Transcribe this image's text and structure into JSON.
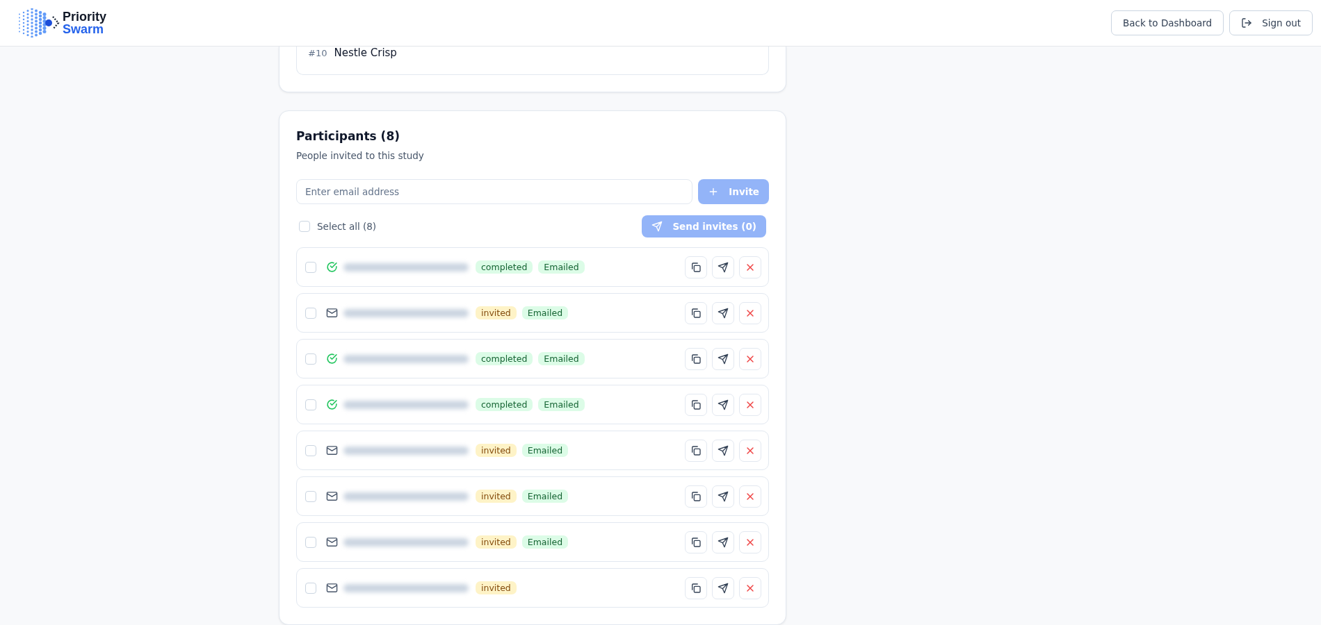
{
  "header": {
    "logo": {
      "line1": "Priority",
      "line2": "Swarm"
    },
    "buttons": [
      {
        "label": "Back to Dashboard",
        "kind": "plain"
      },
      {
        "label": "Sign out",
        "kind": "signout"
      }
    ]
  },
  "ranking_item": {
    "rank": "#10",
    "name": "Nestle Crisp"
  },
  "participants": {
    "title": "Participants (8)",
    "subtitle": "People invited to this study",
    "email_placeholder": "Enter email address",
    "invite_button": "Invite",
    "select_all": {
      "label": "Select all (8)",
      "checked": false
    },
    "send_button": "Send invites (0)",
    "rows": [
      {
        "kind": "completed",
        "checked": false,
        "badges": [
          {
            "label": "completed",
            "kind": "completed"
          },
          {
            "label": "Emailed",
            "kind": "emailed"
          }
        ]
      },
      {
        "kind": "invited",
        "checked": false,
        "badges": [
          {
            "label": "invited",
            "kind": "invited"
          },
          {
            "label": "Emailed",
            "kind": "emailed"
          }
        ]
      },
      {
        "kind": "completed",
        "checked": false,
        "badges": [
          {
            "label": "completed",
            "kind": "completed"
          },
          {
            "label": "Emailed",
            "kind": "emailed"
          }
        ]
      },
      {
        "kind": "completed",
        "checked": false,
        "badges": [
          {
            "label": "completed",
            "kind": "completed"
          },
          {
            "label": "Emailed",
            "kind": "emailed"
          }
        ]
      },
      {
        "kind": "invited",
        "checked": false,
        "badges": [
          {
            "label": "invited",
            "kind": "invited"
          },
          {
            "label": "Emailed",
            "kind": "emailed"
          }
        ]
      },
      {
        "kind": "invited",
        "checked": false,
        "badges": [
          {
            "label": "invited",
            "kind": "invited"
          },
          {
            "label": "Emailed",
            "kind": "emailed"
          }
        ]
      },
      {
        "kind": "invited",
        "checked": false,
        "badges": [
          {
            "label": "invited",
            "kind": "invited"
          },
          {
            "label": "Emailed",
            "kind": "emailed"
          }
        ]
      },
      {
        "kind": "invited",
        "checked": false,
        "badges": [
          {
            "label": "invited",
            "kind": "invited"
          }
        ]
      }
    ]
  }
}
